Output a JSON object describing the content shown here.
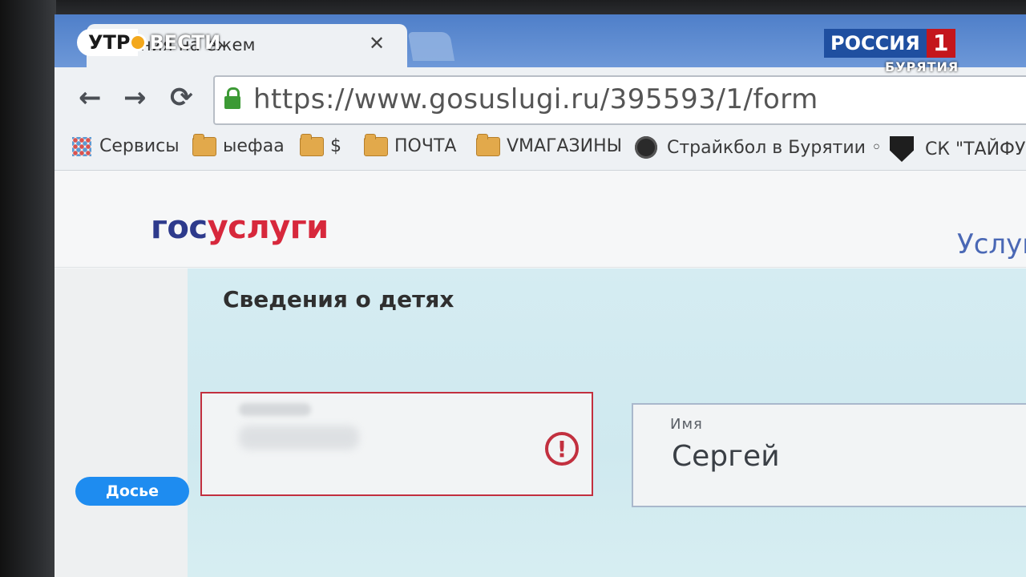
{
  "browser": {
    "tab_title": "ления на ежем",
    "url": "https://www.gosuslugi.ru/395593/1/form",
    "bookmarks": [
      {
        "label": "Сервисы",
        "icon": "apps-grid-icon"
      },
      {
        "label": "ыефаа",
        "icon": "folder-icon"
      },
      {
        "label": "$",
        "icon": "folder-icon"
      },
      {
        "label": "ПОЧТА",
        "icon": "folder-icon"
      },
      {
        "label": "VМАГАЗИНЫ",
        "icon": "folder-icon"
      },
      {
        "label": "Страйкбол в Бурятии ◦",
        "icon": "site-favicon"
      },
      {
        "label": "СК \"ТАЙФУ",
        "icon": "shield-favicon"
      }
    ]
  },
  "site": {
    "logo_part1": "гос",
    "logo_part2": "услуги",
    "nav_services": "Услуг"
  },
  "form": {
    "section_title": "Сведения о детях",
    "surname": {
      "label": "Фамилия",
      "value": "",
      "state": "error"
    },
    "name": {
      "label": "Имя",
      "value": "Сергей"
    }
  },
  "overlay": {
    "program_part1": "УТР",
    "program_part2": "ВЕСТИ",
    "channel_name": "РОССИЯ",
    "channel_number": "1",
    "region": "БУРЯТИЯ",
    "badge": "Досье"
  },
  "colors": {
    "accent_red": "#c2303f",
    "logo_blue": "#2d3a8c",
    "tab_blue": "#4f7fc9",
    "badge_blue": "#1e8cf0"
  }
}
